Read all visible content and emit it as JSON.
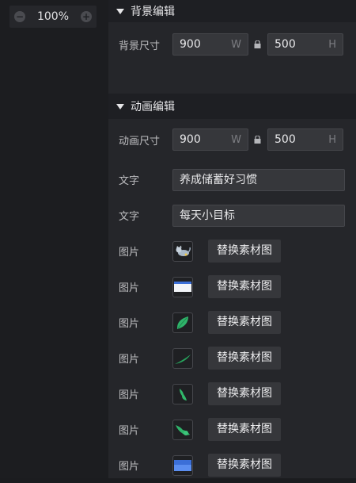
{
  "zoom": {
    "value": "100%",
    "minus": "−",
    "plus": "+"
  },
  "background_section": {
    "title": "背景编辑",
    "size_label": "背景尺寸",
    "width": "900",
    "width_unit": "W",
    "height": "500",
    "height_unit": "H"
  },
  "animation_section": {
    "title": "动画编辑",
    "size_label": "动画尺寸",
    "width": "900",
    "width_unit": "W",
    "height": "500",
    "height_unit": "H",
    "texts": [
      {
        "label": "文字",
        "value": "养成储蓄好习惯"
      },
      {
        "label": "文字",
        "value": "每天小目标"
      }
    ],
    "images": [
      {
        "label": "图片",
        "button": "替换素材图",
        "thumb": "cat-icon"
      },
      {
        "label": "图片",
        "button": "替换素材图",
        "thumb": "card-icon"
      },
      {
        "label": "图片",
        "button": "替换素材图",
        "thumb": "leaf-icon"
      },
      {
        "label": "图片",
        "button": "替换素材图",
        "thumb": "branch-icon"
      },
      {
        "label": "图片",
        "button": "替换素材图",
        "thumb": "bud-icon"
      },
      {
        "label": "图片",
        "button": "替换素材图",
        "thumb": "vine-icon"
      },
      {
        "label": "图片",
        "button": "替换素材图",
        "thumb": "water-icon"
      }
    ]
  },
  "colors": {
    "panel_bg": "#25262a",
    "input_bg": "#36373b",
    "leaf_green": "#2fb36a",
    "blue": "#3b6fd8"
  }
}
